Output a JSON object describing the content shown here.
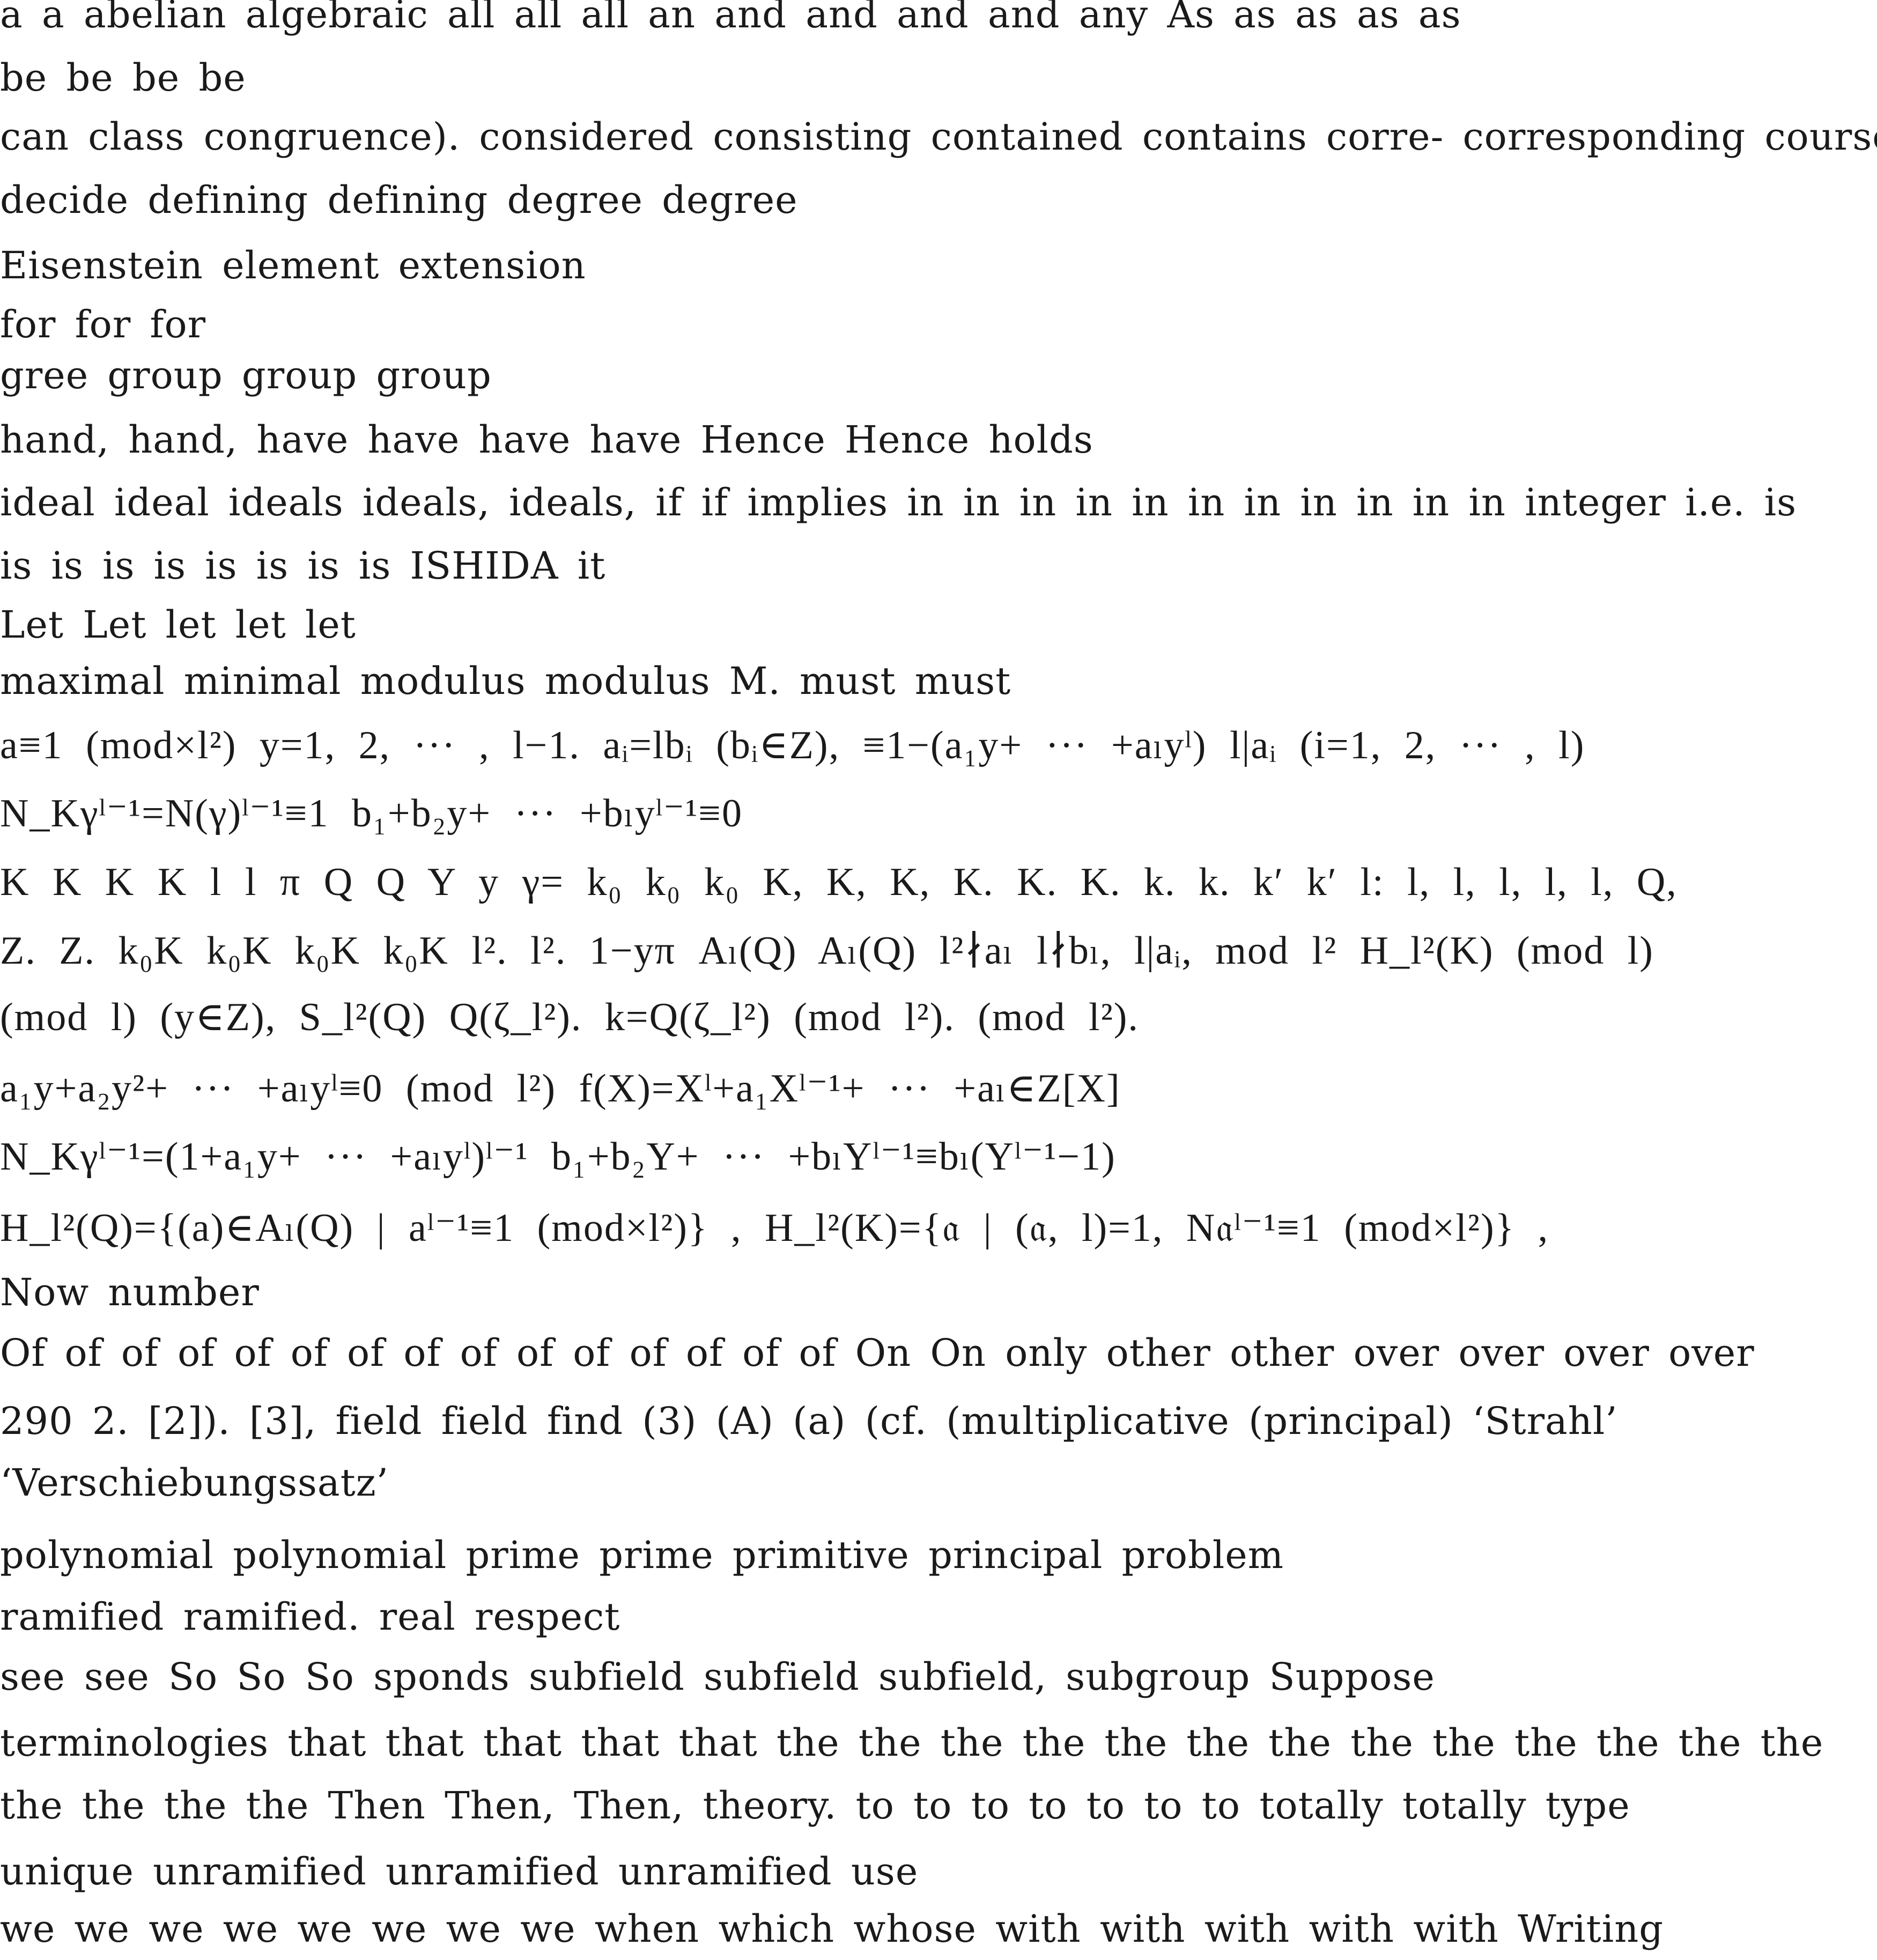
{
  "lines": [
    "a a abelian algebraic all all all an and and and and any As as as as as",
    "be be be be",
    "can class congruence). considered consisting contained contains corre- corresponding course,",
    "decide defining defining degree degree",
    "Eisenstein element extension",
    "for for for",
    "gree group group group",
    "hand, hand, have have have have Hence Hence holds",
    "ideal ideal ideals ideals, ideals, if if implies in in in in in in in in in in in integer i.e. is",
    "is is is is is is is is ISHIDA it",
    "Let Let let let let",
    "maximal minimal modulus modulus M. must must",
    "a≡1 (mod×l²)  y=1, 2, ··· , l−1.  aᵢ=lbᵢ (bᵢ∈Z),  ≡1−(a₁y+ ··· +aₗyˡ)  l|aᵢ (i=1, 2, ··· , l)",
    "N_Kγˡ⁻¹=N(γ)ˡ⁻¹≡1  b₁+b₂y+ ··· +bₗyˡ⁻¹≡0",
    "K K K K l l π Q Q Y y γ= k₀ k₀ k₀ K, K, K, K. K. K. k. k. k′ k′ l: l, l, l, l, l, Q,",
    "Z. Z. k₀K k₀K k₀K k₀K l². l². 1−yπ Aₗ(Q) Aₗ(Q) l²∤aₗ l∤bₗ, l|aᵢ, mod l² H_l²(K) (mod l)",
    "(mod l) (y∈Z), S_l²(Q) Q(ζ_l²). k=Q(ζ_l²) (mod l²). (mod l²).",
    "a₁y+a₂y²+ ··· +aₗyˡ≡0 (mod l²)  f(X)=Xˡ+a₁Xˡ⁻¹+ ··· +aₗ∈Z[X]",
    "N_Kγˡ⁻¹=(1+a₁y+ ··· +aₗyˡ)ˡ⁻¹  b₁+b₂Y+ ··· +bₗYˡ⁻¹≡bₗ(Yˡ⁻¹−1)",
    "H_l²(Q)={(a)∈Aₗ(Q) | aˡ⁻¹≡1 (mod×l²)} ,  H_l²(K)={𝔞 | (𝔞, l)=1, N𝔞ˡ⁻¹≡1 (mod×l²)} ,",
    "Now number",
    "Of of of of of of of of of of of of of of of On On only other other over over over over",
    "290 2. [2]). [3], field field find (3) (A) (a) (cf. (multiplicative (principal) ‘Strahl’",
    "‘Verschiebungssatz’",
    "polynomial polynomial prime prime primitive principal problem",
    "ramified ramified. real respect",
    "see see So So So sponds subfield subfield subfield, subgroup Suppose",
    "terminologies that that that that that the the the the the the the the the the the the the",
    "the the the the Then Then, Then, theory. to to to to to to to totally totally type",
    "unique unramified unramified unramified use",
    "we we we we we we we we when which whose with with with with with Writing"
  ]
}
